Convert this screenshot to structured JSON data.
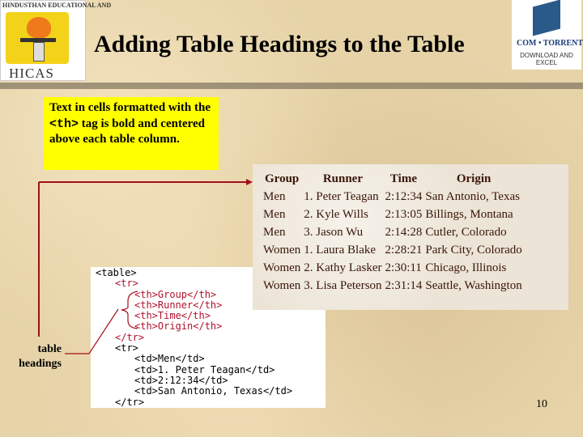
{
  "slide": {
    "title": "Adding Table Headings to the Table",
    "page_number": "10",
    "logo_left": {
      "top_text": "HINDUSTHAN EDUCATIONAL AND",
      "name": "HICAS"
    },
    "logo_right": {
      "name": "COM • TORRENT",
      "sub": "DOWNLOAD AND EXCEL"
    },
    "callout": {
      "before": "Text in cells formatted with the ",
      "tag": "<th>",
      "after": " tag is bold and centered above each table column."
    },
    "annotation_label": "table headings",
    "accent_color": "#a0101a",
    "code_lines": [
      {
        "text": "<table>",
        "indent": 0,
        "highlight": false
      },
      {
        "text": "<tr>",
        "indent": 1,
        "highlight": true
      },
      {
        "text": "<th>Group</th>",
        "indent": 2,
        "highlight": true
      },
      {
        "text": "<th>Runner</th>",
        "indent": 2,
        "highlight": true
      },
      {
        "text": "<th>Time</th>",
        "indent": 2,
        "highlight": true
      },
      {
        "text": "<th>Origin</th>",
        "indent": 2,
        "highlight": true
      },
      {
        "text": "</tr>",
        "indent": 1,
        "highlight": true
      },
      {
        "text": "<tr>",
        "indent": 1,
        "highlight": false
      },
      {
        "text": "<td>Men</td>",
        "indent": 2,
        "highlight": false
      },
      {
        "text": "<td>1. Peter Teagan</td>",
        "indent": 2,
        "highlight": false
      },
      {
        "text": "<td>2:12:34</td>",
        "indent": 2,
        "highlight": false
      },
      {
        "text": "<td>San Antonio, Texas</td>",
        "indent": 2,
        "highlight": false
      },
      {
        "text": "</tr>",
        "indent": 1,
        "highlight": false
      }
    ],
    "table": {
      "headers": [
        "Group",
        "Runner",
        "Time",
        "Origin"
      ],
      "rows": [
        [
          "Men",
          "1. Peter Teagan",
          "2:12:34",
          "San Antonio, Texas"
        ],
        [
          "Men",
          "2. Kyle Wills",
          "2:13:05",
          "Billings, Montana"
        ],
        [
          "Men",
          "3. Jason Wu",
          "2:14:28",
          "Cutler, Colorado"
        ],
        [
          "Women",
          "1. Laura Blake",
          "2:28:21",
          "Park City, Colorado"
        ],
        [
          "Women",
          "2. Kathy Lasker",
          "2:30:11",
          "Chicago, Illinois"
        ],
        [
          "Women",
          "3. Lisa Peterson",
          "2:31:14",
          "Seattle, Washington"
        ]
      ]
    }
  }
}
